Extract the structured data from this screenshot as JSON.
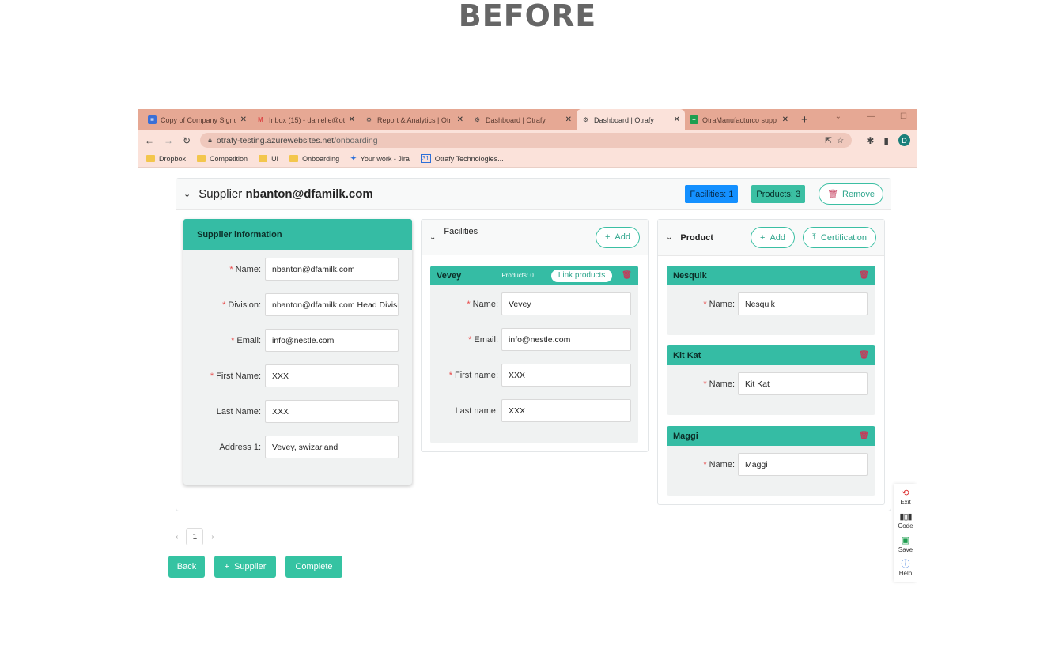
{
  "heading": "BEFORE",
  "browser": {
    "tabs": [
      {
        "title": "Copy of Company Signu",
        "icon": "docs-icon",
        "color": "#3b6fd6"
      },
      {
        "title": "Inbox (15) - danielle@ot",
        "icon": "gmail-icon",
        "color": "#d44"
      },
      {
        "title": "Report & Analytics | Otr",
        "icon": "gear-icon",
        "color": "#444"
      },
      {
        "title": "Dashboard | Otrafy",
        "icon": "gear-icon",
        "color": "#444"
      },
      {
        "title": "Dashboard | Otrafy",
        "icon": "gear-icon",
        "color": "#444",
        "active": true
      },
      {
        "title": "OtraManufacturco supp",
        "icon": "sheets-icon",
        "color": "#1e9e4f"
      }
    ],
    "close_glyph": "✕",
    "new_tab": "+",
    "url_host": "otrafy-testing.azurewebsites.net",
    "url_path": "/onboarding",
    "avatar": "D",
    "bookmarks": [
      "Dropbox",
      "Competition",
      "UI",
      "Onboarding",
      "Your work - Jira",
      "Otrafy Technologies..."
    ]
  },
  "supplier": {
    "label": "Supplier",
    "email": "nbanton@dfamilk.com",
    "facilities_badge": "Facilities: 1",
    "products_badge": "Products: 3",
    "remove_label": "Remove"
  },
  "info": {
    "title": "Supplier information",
    "fields": [
      {
        "label": "Name",
        "value": "nbanton@dfamilk.com",
        "required": true
      },
      {
        "label": "Division",
        "value": "nbanton@dfamilk.com Head Divisi",
        "required": true
      },
      {
        "label": "Email",
        "value": "info@nestle.com",
        "required": true
      },
      {
        "label": "First Name",
        "value": "XXX",
        "required": true
      },
      {
        "label": "Last Name",
        "value": "XXX",
        "required": false
      },
      {
        "label": "Address 1",
        "value": "Vevey, swizarland",
        "required": false
      }
    ]
  },
  "facilities": {
    "title": "Facilities",
    "add_label": "Add",
    "card": {
      "name": "Vevey",
      "products_count": "Products: 0",
      "link_label": "Link products",
      "fields": [
        {
          "label": "Name",
          "value": "Vevey",
          "required": true
        },
        {
          "label": "Email",
          "value": "info@nestle.com",
          "required": true
        },
        {
          "label": "First name",
          "value": "XXX",
          "required": true
        },
        {
          "label": "Last name",
          "value": "XXX",
          "required": false
        }
      ]
    }
  },
  "products": {
    "title": "Product",
    "add_label": "Add",
    "cert_label": "Certification",
    "items": [
      {
        "name": "Nesquik",
        "field_label": "Name",
        "value": "Nesquik"
      },
      {
        "name": "Kit Kat",
        "field_label": "Name",
        "value": "Kit Kat"
      },
      {
        "name": "Maggi",
        "field_label": "Name",
        "value": "Maggi"
      }
    ]
  },
  "pager": {
    "page": "1"
  },
  "buttons": {
    "back": "Back",
    "supplier": "Supplier",
    "complete": "Complete"
  },
  "sidebar": [
    {
      "label": "Exit",
      "icon": "exit-icon"
    },
    {
      "label": "Code",
      "icon": "barcode-icon"
    },
    {
      "label": "Save",
      "icon": "save-icon"
    },
    {
      "label": "Help",
      "icon": "help-icon"
    }
  ]
}
